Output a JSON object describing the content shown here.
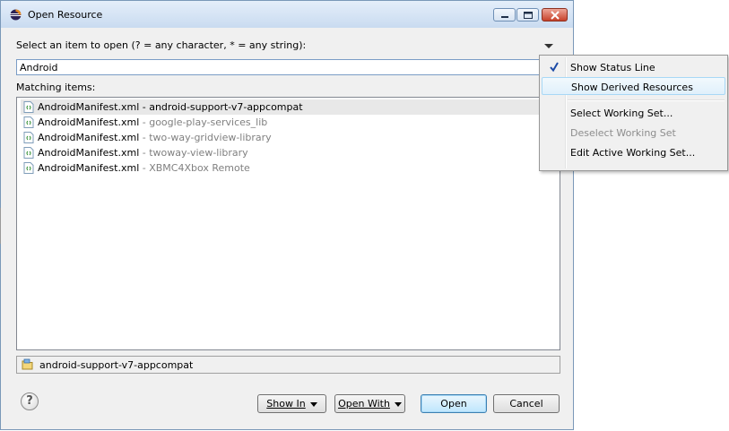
{
  "window": {
    "title": "Open Resource"
  },
  "dialog": {
    "prompt": "Select an item to open (? = any character, * = any string):",
    "search_value": "Android",
    "matching_label": "Matching items:",
    "items": [
      {
        "file": "AndroidManifest.xml",
        "sep": " - ",
        "project": "android-support-v7-appcompat"
      },
      {
        "file": "AndroidManifest.xml",
        "sep": " - ",
        "project": "google-play-services_lib"
      },
      {
        "file": "AndroidManifest.xml",
        "sep": " - ",
        "project": "two-way-gridview-library"
      },
      {
        "file": "AndroidManifest.xml",
        "sep": " - ",
        "project": "twoway-view-library"
      },
      {
        "file": "AndroidManifest.xml",
        "sep": " - ",
        "project": "XBMC4Xbox Remote"
      }
    ],
    "details": "android-support-v7-appcompat"
  },
  "buttons": {
    "show_in": "Show In",
    "open_with": "Open With",
    "open": "Open",
    "cancel": "Cancel"
  },
  "menu": {
    "items": [
      {
        "label": "Show Status Line",
        "checked": true
      },
      {
        "label": "Show Derived Resources"
      },
      {
        "label": "Select Working Set..."
      },
      {
        "label": "Deselect Working Set",
        "disabled": true
      },
      {
        "label": "Edit Active Working Set..."
      }
    ]
  },
  "colors": {
    "selection": "#e8e8e8",
    "project_text": "#808080",
    "check": "#1c4aa6"
  }
}
